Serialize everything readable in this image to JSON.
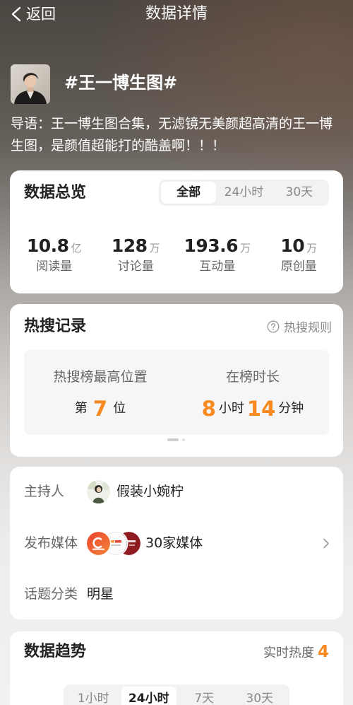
{
  "nav": {
    "back_label": "返回",
    "title": "数据详情"
  },
  "topic": {
    "title": "#王一博生图#",
    "intro": "导语：王一博生图合集，无滤镜无美颜超高清的王一博生图，是颜值超能打的酷盖啊！！！"
  },
  "overview": {
    "title": "数据总览",
    "tabs": [
      {
        "label": "全部",
        "selected": true
      },
      {
        "label": "24小时",
        "selected": false
      },
      {
        "label": "30天",
        "selected": false
      }
    ],
    "stats": [
      {
        "value": "10.8",
        "unit": "亿",
        "label": "阅读量"
      },
      {
        "value": "128",
        "unit": "万",
        "label": "讨论量"
      },
      {
        "value": "193.6",
        "unit": "万",
        "label": "互动量"
      },
      {
        "value": "10",
        "unit": "万",
        "label": "原创量"
      }
    ]
  },
  "hot_search": {
    "title": "热搜记录",
    "rules_label": "热搜规则",
    "peak": {
      "label": "热搜榜最高位置",
      "prefix": "第",
      "value": "7",
      "suffix": "位"
    },
    "duration": {
      "label": "在榜时长",
      "hours": "8",
      "hours_unit": "小时",
      "minutes": "14",
      "minutes_unit": "分钟"
    }
  },
  "info": {
    "host": {
      "label": "主持人",
      "name": "假装小婉柠"
    },
    "media": {
      "label": "发布媒体",
      "count_text": "30家媒体"
    },
    "category": {
      "label": "话题分类",
      "value": "明星"
    }
  },
  "trend": {
    "title": "数据趋势",
    "realtime_label": "实时热度",
    "realtime_value": "4",
    "tabs": [
      {
        "label": "1小时",
        "selected": false
      },
      {
        "label": "24小时",
        "selected": true
      },
      {
        "label": "7天",
        "selected": false
      },
      {
        "label": "30天",
        "selected": false
      }
    ]
  },
  "icons": {
    "back": "chevron-left-icon",
    "rules": "question-circle-icon",
    "media_more": "chevron-right-icon"
  },
  "colors": {
    "accent": "#f7891f",
    "card_background": "#ffffff",
    "text_primary": "#222222",
    "text_secondary": "#666666",
    "tab_background": "#f2f2f2"
  }
}
